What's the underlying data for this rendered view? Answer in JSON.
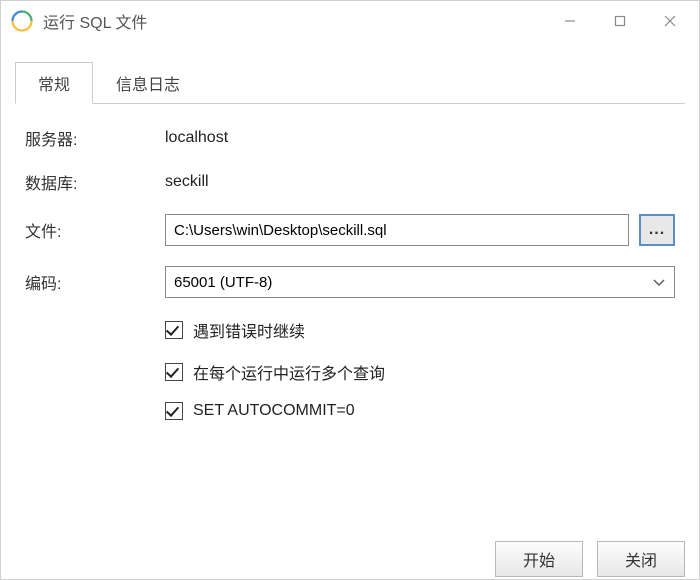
{
  "window": {
    "title": "运行 SQL 文件"
  },
  "tabs": {
    "general": "常规",
    "log": "信息日志"
  },
  "form": {
    "server_label": "服务器:",
    "server_value": "localhost",
    "database_label": "数据库:",
    "database_value": "seckill",
    "file_label": "文件:",
    "file_value": "C:\\Users\\win\\Desktop\\seckill.sql",
    "browse_label": "...",
    "encoding_label": "编码:",
    "encoding_value": "65001 (UTF-8)"
  },
  "checkboxes": {
    "continue_on_error": "遇到错误时继续",
    "multi_queries_per_run": "在每个运行中运行多个查询",
    "set_autocommit": "SET AUTOCOMMIT=0"
  },
  "footer": {
    "start": "开始",
    "close": "关闭"
  }
}
